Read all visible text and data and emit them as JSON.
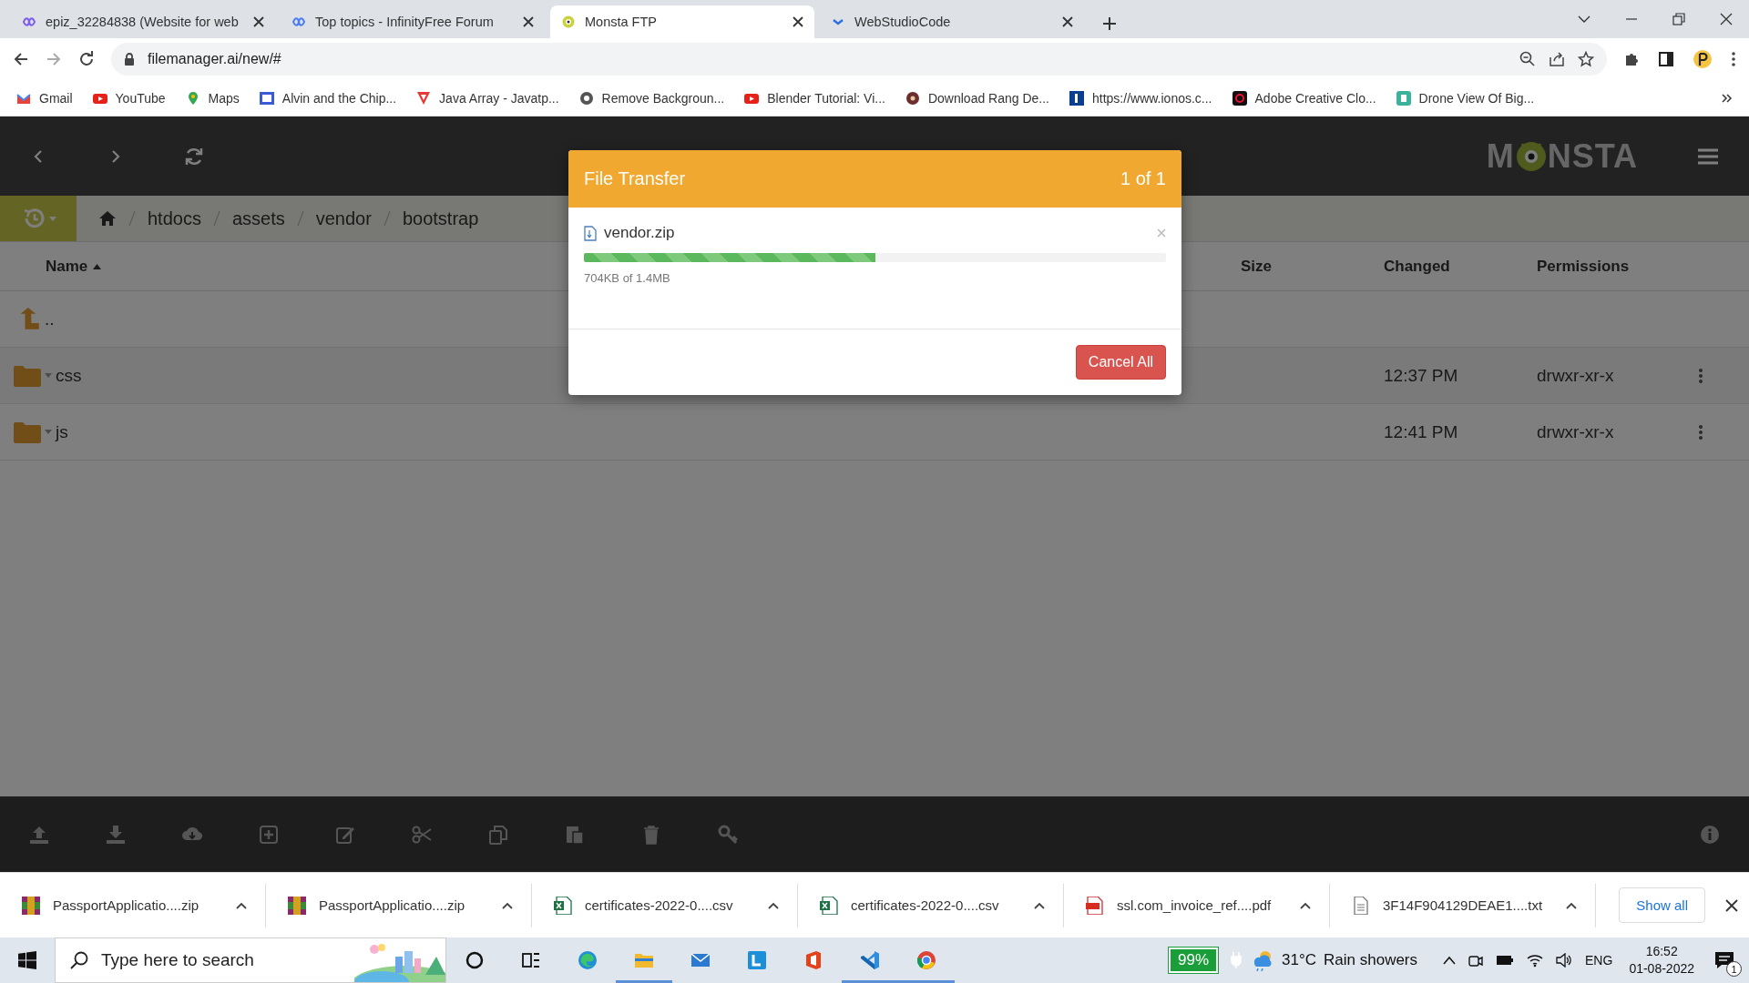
{
  "browser_tabs": [
    {
      "title": "epiz_32284838 (Website for web",
      "selected": false
    },
    {
      "title": "Top topics - InfinityFree Forum",
      "selected": false
    },
    {
      "title": "Monsta FTP",
      "selected": true
    },
    {
      "title": "WebStudioCode",
      "selected": false
    }
  ],
  "address_bar": {
    "url": "filemanager.ai/new/#"
  },
  "bookmarks": [
    "Gmail",
    "YouTube",
    "Maps",
    "Alvin and the Chip...",
    "Java Array - Javatp...",
    "Remove Backgroun...",
    "Blender Tutorial: Vi...",
    "Download Rang De...",
    "https://www.ionos.c...",
    "Adobe Creative Clo...",
    "Drone View Of Big..."
  ],
  "app": {
    "logo_start": "M",
    "logo_end": "NSTA",
    "breadcrumb": [
      "htdocs",
      "assets",
      "vendor",
      "bootstrap"
    ],
    "columns": [
      "Name",
      "Size",
      "Changed",
      "Permissions"
    ],
    "rows": [
      {
        "kind": "parent",
        "name": ".."
      },
      {
        "kind": "folder",
        "name": "css",
        "changed": "12:37 PM",
        "permissions": "drwxr-xr-x"
      },
      {
        "kind": "folder",
        "name": "js",
        "changed": "12:41 PM",
        "permissions": "drwxr-xr-x"
      }
    ],
    "transfer_dialog": {
      "title": "File Transfer",
      "count": "1 of 1",
      "file": "vendor.zip",
      "level": 0.5,
      "progress": "704KB of 1.4MB",
      "cancel": "Cancel All"
    }
  },
  "downloads": [
    {
      "name": "PassportApplicatio....zip",
      "kind": "zip"
    },
    {
      "name": "PassportApplicatio....zip",
      "kind": "zip"
    },
    {
      "name": "certificates-2022-0....csv",
      "kind": "csv"
    },
    {
      "name": "certificates-2022-0....csv",
      "kind": "csv"
    },
    {
      "name": "ssl.com_invoice_ref....pdf",
      "kind": "pdf"
    },
    {
      "name": "3F14F904129DEAE1....txt",
      "kind": "txt"
    }
  ],
  "show_all": "Show all",
  "taskbar": {
    "search_placeholder": "Type here to search",
    "battery": "99%",
    "temperature": "31°C",
    "weather": "Rain showers",
    "language": "ENG",
    "time": "16:52",
    "date": "01-08-2022",
    "notifications": "1"
  }
}
